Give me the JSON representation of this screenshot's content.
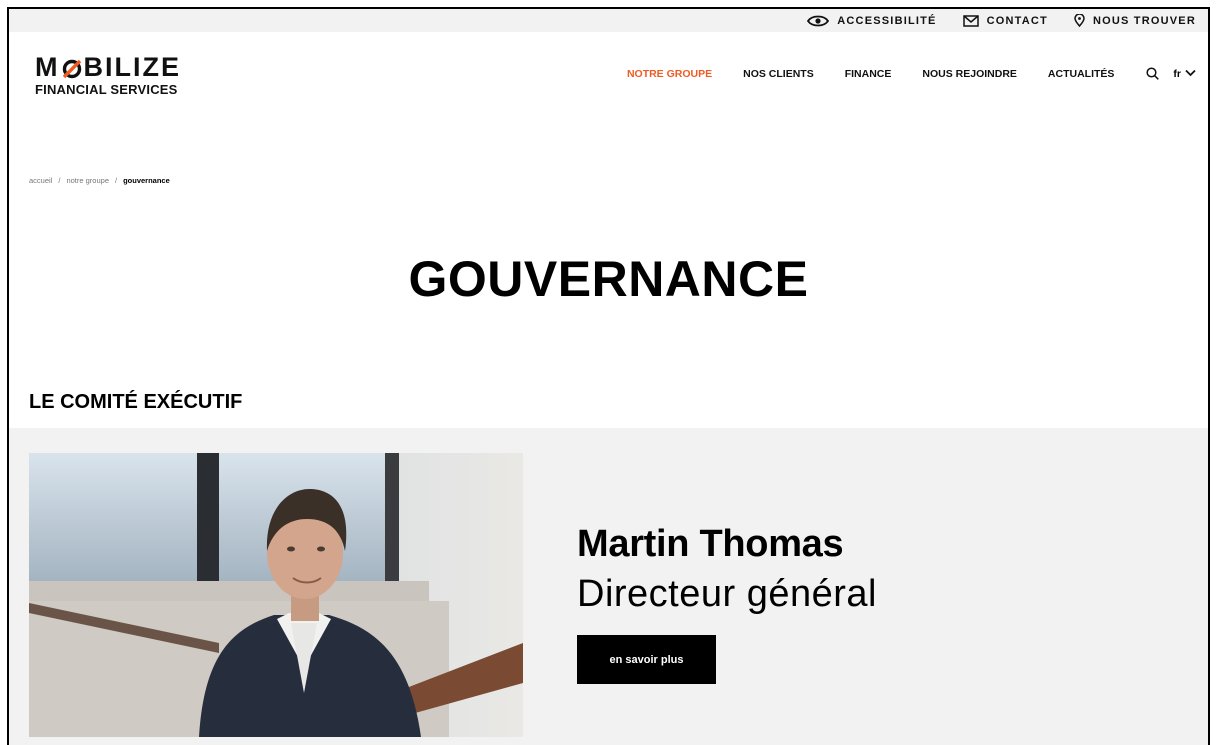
{
  "utility": {
    "accessibility": "ACCESSIBILITÉ",
    "contact": "CONTACT",
    "find_us": "NOUS TROUVER"
  },
  "logo": {
    "line1_left": "M",
    "line1_right": "BILIZE",
    "line2": "FINANCIAL SERVICES"
  },
  "nav": {
    "items": [
      "NOTRE GROUPE",
      "NOS CLIENTS",
      "FINANCE",
      "NOUS REJOINDRE",
      "ACTUALITÉS"
    ],
    "lang": "fr"
  },
  "breadcrumb": {
    "items": [
      "accueil",
      "notre groupe",
      "gouvernance"
    ],
    "separator": "/"
  },
  "page": {
    "title": "GOUVERNANCE",
    "section": "LE COMITÉ EXÉCUTIF"
  },
  "profile": {
    "name": "Martin Thomas",
    "role": "Directeur général",
    "button": "en savoir plus"
  },
  "colors": {
    "accent": "#ef5b23",
    "panel": "#f2f2f2",
    "text": "#111111"
  }
}
